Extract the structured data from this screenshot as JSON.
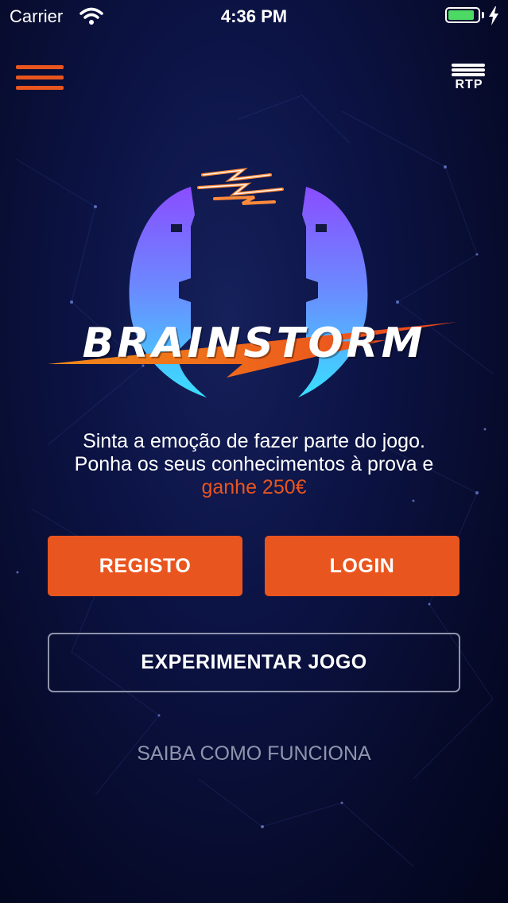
{
  "status_bar": {
    "carrier": "Carrier",
    "time": "4:36 PM",
    "battery_level": 0.9
  },
  "header": {
    "menu_icon": "hamburger-menu-icon",
    "brand": "RTP"
  },
  "logo": {
    "text": "BRAINSTORM"
  },
  "tagline": {
    "line1": "Sinta a emoção de fazer parte do jogo.",
    "line2": "Ponha os seus conhecimentos à prova e",
    "highlight": "ganhe 250€"
  },
  "actions": {
    "register": "REGISTO",
    "login": "LOGIN",
    "try_game": "EXPERIMENTAR JOGO",
    "how_it_works": "SAIBA COMO FUNCIONA"
  },
  "colors": {
    "accent": "#e9551e",
    "background": "#0c1446",
    "muted_text": "#8f95ac"
  }
}
